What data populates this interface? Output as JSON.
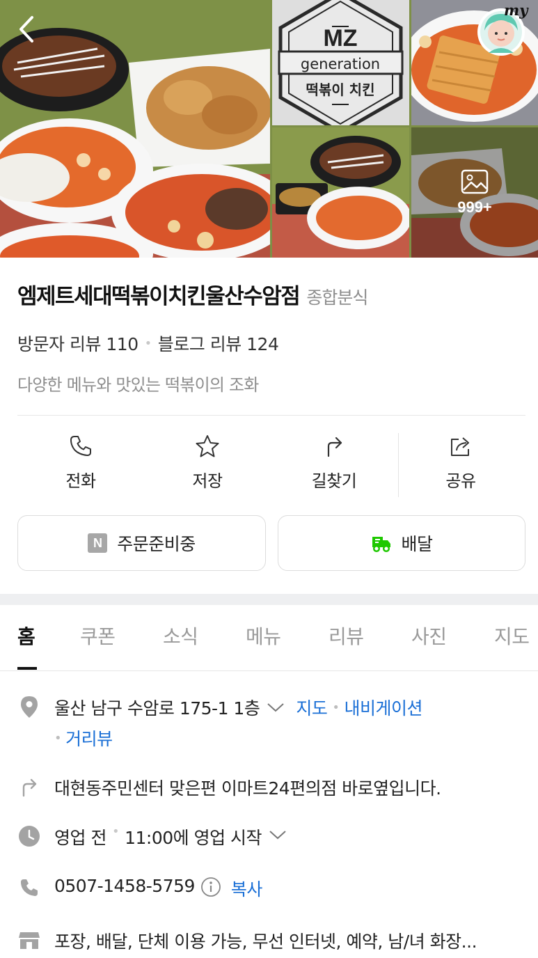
{
  "photos": {
    "logo_text_top": "MZ",
    "logo_text_mid": "generation",
    "logo_text_bottom": "떡볶이 치킨",
    "more_count": "999+",
    "profile_label": "my"
  },
  "place": {
    "name": "엠제트세대떡볶이치킨울산수암점",
    "category": "종합분식",
    "visitor_review": "방문자 리뷰 110",
    "blog_review": "블로그 리뷰 124",
    "description": "다양한 메뉴와 맛있는 떡볶이의 조화"
  },
  "actions": {
    "call": "전화",
    "save": "저장",
    "directions": "길찾기",
    "share": "공유"
  },
  "order": {
    "naver_order_badge": "N",
    "naver_order": "주문준비중",
    "delivery": "배달",
    "delivery_color": "#1ec800"
  },
  "tabs": [
    "홈",
    "쿠폰",
    "소식",
    "메뉴",
    "리뷰",
    "사진",
    "지도"
  ],
  "details": {
    "address": "울산 남구 수암로 175-1 1층",
    "map_link": "지도",
    "navigation_link": "내비게이션",
    "street_view_link": "거리뷰",
    "directions_note": "대현동주민센터 맞은편 이마트24편의점 바로옆입니다.",
    "status": "영업 전",
    "open_time": "11:00에 영업 시작",
    "phone": "0507-1458-5759",
    "copy_link": "복사",
    "amenities": "포장, 배달, 단체 이용 가능, 무선 인터넷, 예약, 남/녀 화장..."
  },
  "colors": {
    "link": "#1a6fd6",
    "icon_gray": "#9b9b9b"
  }
}
